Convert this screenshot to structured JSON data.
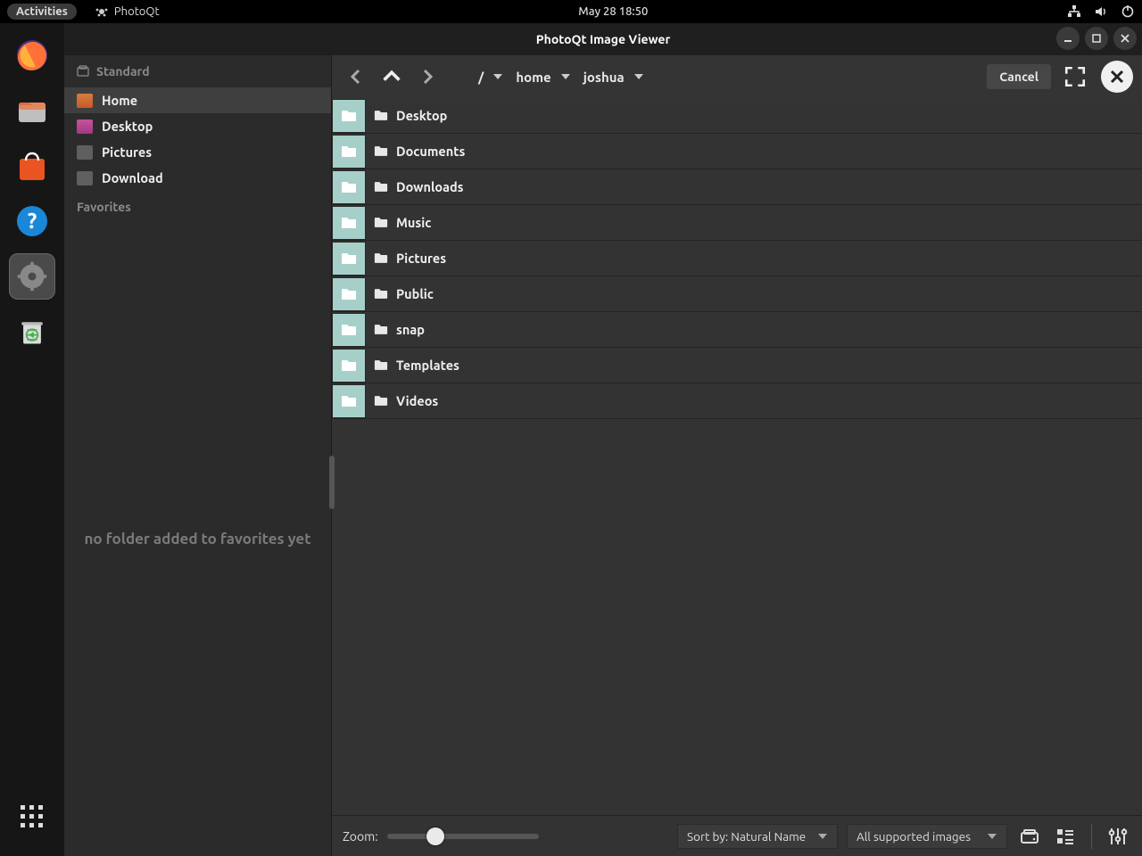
{
  "topbar": {
    "activities": "Activities",
    "app_name": "PhotoQt",
    "datetime": "May 28  18:50"
  },
  "window": {
    "title": "PhotoQt Image Viewer"
  },
  "sidebar": {
    "section_standard": "Standard",
    "section_favorites": "Favorites",
    "items": [
      {
        "label": "Home"
      },
      {
        "label": "Desktop"
      },
      {
        "label": "Pictures"
      },
      {
        "label": "Download"
      }
    ],
    "favorites_empty": "no folder added to favorites yet"
  },
  "toolbar": {
    "cancel": "Cancel",
    "crumbs": [
      {
        "label": "/"
      },
      {
        "label": "home"
      },
      {
        "label": "joshua"
      }
    ]
  },
  "files": [
    {
      "name": "Desktop"
    },
    {
      "name": "Documents"
    },
    {
      "name": "Downloads"
    },
    {
      "name": "Music"
    },
    {
      "name": "Pictures"
    },
    {
      "name": "Public"
    },
    {
      "name": "snap"
    },
    {
      "name": "Templates"
    },
    {
      "name": "Videos"
    }
  ],
  "bottombar": {
    "zoom_label": "Zoom:",
    "sort_label": "Sort by: Natural Name",
    "filter_label": "All supported images"
  }
}
